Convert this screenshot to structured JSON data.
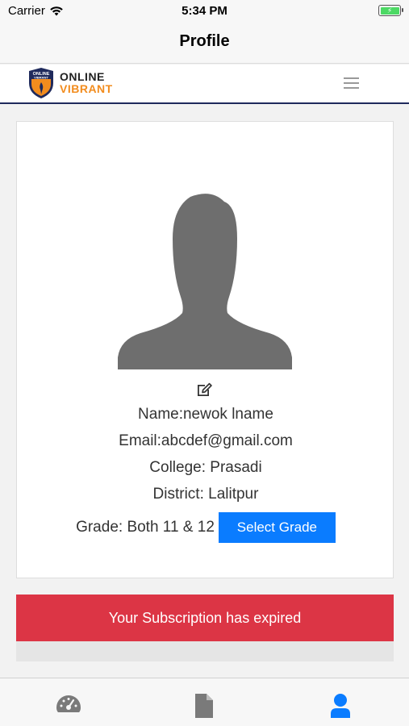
{
  "status_bar": {
    "carrier": "Carrier",
    "time": "5:34 PM"
  },
  "nav": {
    "title": "Profile"
  },
  "header": {
    "logo_top": "ONLINE",
    "logo_bottom": "VIBRANT",
    "logo_badge_top": "ONLINE",
    "logo_badge_bottom": "VIBRANT",
    "menu_icon": "hamburger-icon"
  },
  "profile": {
    "name": "Name:newok lname",
    "email": "Email:abcdef@gmail.com",
    "college": "College: Prasadi",
    "district": "District: Lalitpur",
    "grade": "Grade: Both 11 & 12",
    "select_grade_label": "Select Grade",
    "edit_icon": "edit-icon"
  },
  "alert": {
    "message": "Your Subscription has expired",
    "color": "#dc3545"
  },
  "tabs": [
    {
      "icon": "dashboard-icon",
      "active": false
    },
    {
      "icon": "document-icon",
      "active": false
    },
    {
      "icon": "user-icon",
      "active": true
    }
  ],
  "colors": {
    "accent": "#0a7cff",
    "brand_orange": "#f28c1e",
    "brand_navy": "#1f2a5c",
    "tab_active": "#0a7cff",
    "tab_inactive": "#7a7a7a"
  }
}
